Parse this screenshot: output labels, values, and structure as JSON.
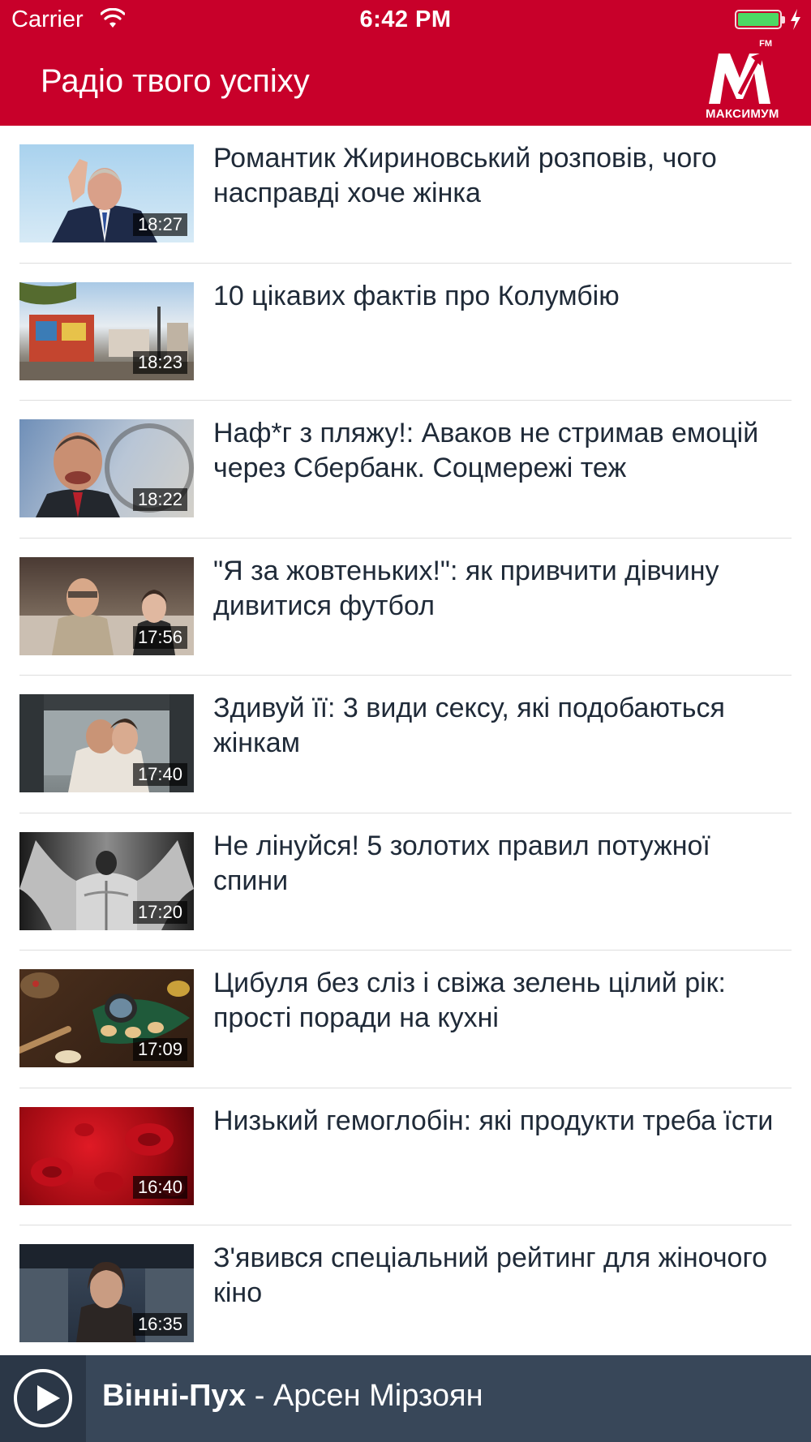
{
  "status_bar": {
    "carrier": "Carrier",
    "time": "6:42 PM",
    "wifi_icon": "wifi-icon",
    "battery_icon": "battery-icon",
    "charging_icon": "charging-bolt-icon",
    "battery_color": "#4cd964"
  },
  "header": {
    "title": "Радіо твого успіху",
    "background": "#c8002a",
    "logo": {
      "fm": "FM",
      "word": "МАКСИМУМ"
    }
  },
  "news": [
    {
      "title": "Романтик Жириновський розповів, чого насправді хоче жінка",
      "duration": "18:27"
    },
    {
      "title": "10 цікавих фактів про Колумбію",
      "duration": "18:23"
    },
    {
      "title": "Наф*г з пляжу!: Аваков не стримав емоцій через Сбербанк. Соцмережі теж",
      "duration": "18:22"
    },
    {
      "title": "\"Я за жовтеньких!\": як привчити дівчину дивитися футбол",
      "duration": "17:56"
    },
    {
      "title": "Здивуй її: 3 види сексу, які подобаються жінкам",
      "duration": "17:40"
    },
    {
      "title": "Не лінуйся! 5 золотих правил потужної спини",
      "duration": "17:20"
    },
    {
      "title": "Цибуля без сліз і свіжа зелень цілий рік: прості поради на кухні",
      "duration": "17:09"
    },
    {
      "title": "Низький гемоглобін: які продукти треба їсти",
      "duration": "16:40"
    },
    {
      "title": "З'явився спеціальний рейтинг для жіночого кіно",
      "duration": "16:35"
    }
  ],
  "player": {
    "play_icon": "play-icon",
    "track_title": "Вінні-Пух",
    "separator": " - ",
    "artist": "Арсен Мірзоян",
    "background": "#384759"
  }
}
